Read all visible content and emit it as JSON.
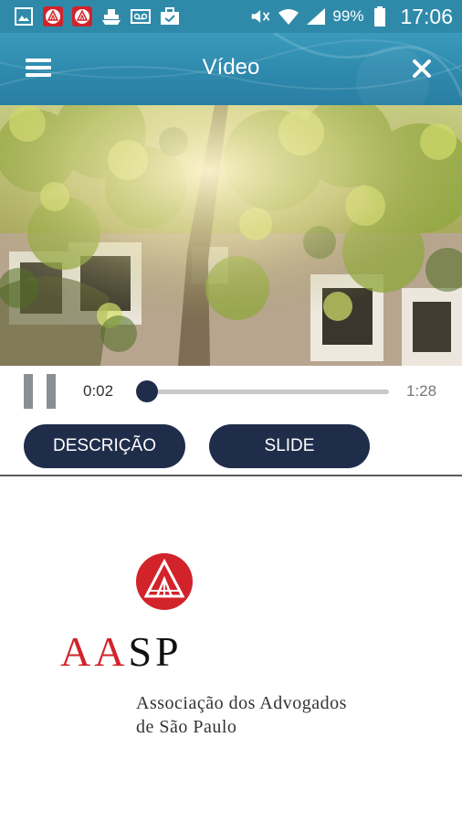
{
  "status_bar": {
    "notification_icons": [
      "image-icon",
      "aasp-icon",
      "aasp-icon",
      "ship-icon",
      "voicemail-icon",
      "briefcase-icon"
    ],
    "battery": "99%",
    "time": "17:06"
  },
  "app_bar": {
    "title": "Vídeo",
    "menu_icon": "hamburger-menu-icon",
    "close_icon": "close-icon"
  },
  "player": {
    "current_time": "0:02",
    "total_time": "1:28",
    "progress": 0.02,
    "state": "playing"
  },
  "buttons": {
    "description": "DESCRIÇÃO",
    "slide": "SLIDE"
  },
  "logo": {
    "wordmark_red": "AA",
    "wordmark_black": "SP",
    "subtitle_line1": "Associação dos Advogados",
    "subtitle_line2": "de São Paulo"
  },
  "colors": {
    "app_bar": "#2f8aaa",
    "accent_dark": "#1f2d4a",
    "brand_red": "#d2232a"
  }
}
